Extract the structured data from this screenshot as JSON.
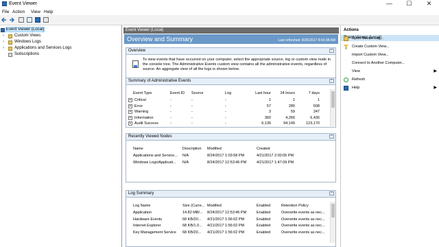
{
  "window": {
    "title": "Event Viewer",
    "minimize": "—",
    "maximize": "☐",
    "close": "✕"
  },
  "menu": [
    "File",
    "Action",
    "View",
    "Help"
  ],
  "tree": [
    {
      "label": "Event Viewer (Local)",
      "selected": true
    },
    {
      "label": "Custom Views"
    },
    {
      "label": "Windows Logs"
    },
    {
      "label": "Applications and Services Logs"
    },
    {
      "label": "Subscriptions"
    }
  ],
  "center": {
    "header": "Event Viewer (Local)",
    "banner_title": "Overview and Summary",
    "last_refreshed": "Last refreshed: 8/25/2017 8:43:38 AM",
    "overview": {
      "title": "Overview",
      "text": "To view events that have occurred on your computer, select the appropriate source, log or custom view node in the console tree. The Administrative Events custom view contains all the administrative events, regardless of source. An aggregate view of all the logs is shown below."
    },
    "summary": {
      "title": "Summary of Administrative Events",
      "columns": [
        "Event Type",
        "Event ID",
        "Source",
        "Log",
        "Last hour",
        "24 hours",
        "7 days"
      ],
      "rows": [
        [
          "Critical",
          "-",
          "-",
          "-",
          "1",
          "1",
          "1"
        ],
        [
          "Error",
          "-",
          "-",
          "-",
          "57",
          "280",
          "508"
        ],
        [
          "Warning",
          "-",
          "-",
          "-",
          "3",
          "59",
          "247"
        ],
        [
          "Information",
          "-",
          "-",
          "-",
          "360",
          "4,266",
          "6,436"
        ],
        [
          "Audit Success",
          "-",
          "-",
          "-",
          "6,136",
          "94,149",
          "123,170"
        ]
      ]
    },
    "recent": {
      "title": "Recently Viewed Nodes",
      "columns": [
        "Name",
        "Description",
        "Modified",
        "Created"
      ],
      "rows": [
        [
          "Applications and Service...",
          "N/A",
          "8/24/2017 1:03:58 PM",
          "4/21/2017 2:00:05 PM"
        ],
        [
          "Windows Logs\\Applicati...",
          "N/A",
          "8/24/2017 12:53:46 PM",
          "4/21/2017 1:47:09 PM"
        ]
      ]
    },
    "logsummary": {
      "title": "Log Summary",
      "columns": [
        "Log Name",
        "Size (Curre...",
        "Modified",
        "Enabled",
        "Retention Policy"
      ],
      "rows": [
        [
          "Application",
          "14.82 MB/...",
          "8/24/2017 12:53:46 PM",
          "Enabled",
          "Overwrite events as nec..."
        ],
        [
          "Hardware Events",
          "68 KB/20...",
          "4/21/2017 1:56:02 PM",
          "Enabled",
          "Overwrite events as nec..."
        ],
        [
          "Internet Explorer",
          "68 KB/1.0...",
          "4/21/2017 1:56:02 PM",
          "Enabled",
          "Overwrite events as nec..."
        ],
        [
          "Key Management Service",
          "68 KB/20...",
          "4/21/2017 1:56:02 PM",
          "Enabled",
          "Overwrite events as nec..."
        ]
      ]
    }
  },
  "actions": {
    "title": "Actions",
    "section": "Event Viewer (Local)",
    "items": [
      {
        "label": "Open Saved Log...",
        "icon": "folder-icon"
      },
      {
        "label": "Create Custom View...",
        "icon": "filter-icon"
      },
      {
        "label": "Import Custom View...",
        "icon": ""
      },
      {
        "label": "Connect to Another Computer...",
        "icon": ""
      },
      {
        "label": "View",
        "icon": "",
        "submenu": "▶"
      },
      {
        "label": "Refresh",
        "icon": "refresh-icon"
      },
      {
        "label": "Help",
        "icon": "help-icon",
        "submenu": "▶"
      }
    ]
  }
}
